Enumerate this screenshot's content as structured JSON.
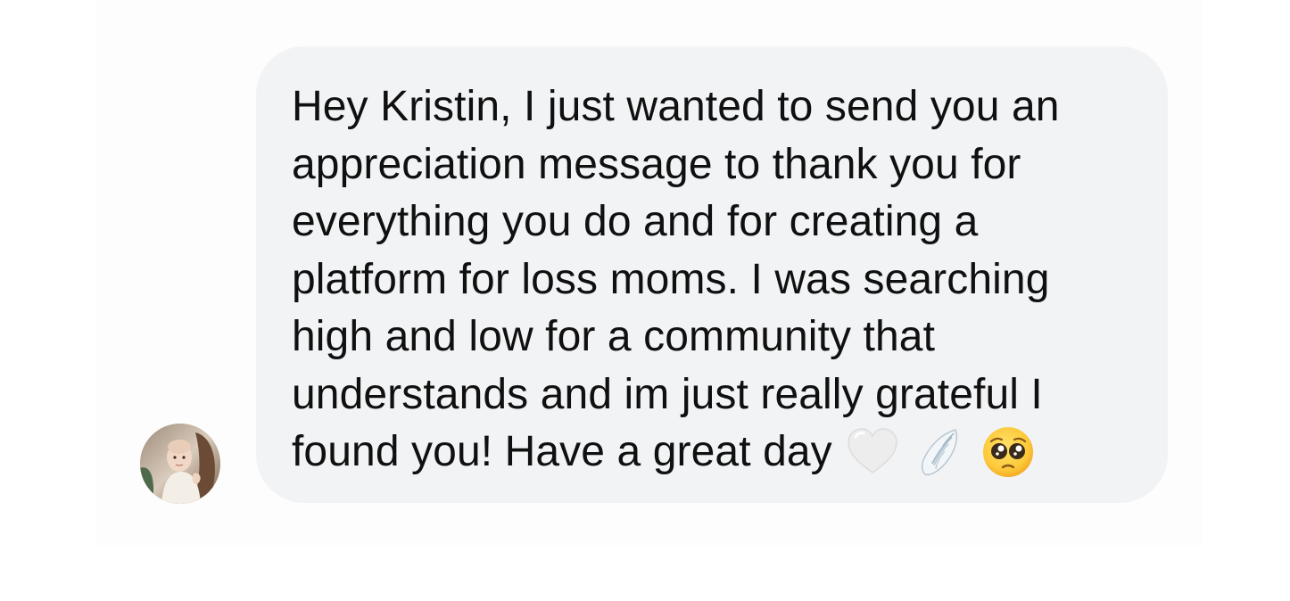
{
  "conversation": {
    "message": {
      "text": "Hey Kristin, I just wanted to send you an appreciation message to thank you for everything you do and for creating a platform for loss moms. I was searching high and low for a community that understands and im just really grateful I found you! Have a great day",
      "emojis": [
        "white-heart-icon",
        "wing-icon",
        "pleading-face-icon"
      ]
    },
    "sender": {
      "avatar_icon": "avatar"
    }
  },
  "colors": {
    "bubble_background": "#f2f3f5",
    "text": "#101010",
    "page_background": "#ffffff"
  }
}
